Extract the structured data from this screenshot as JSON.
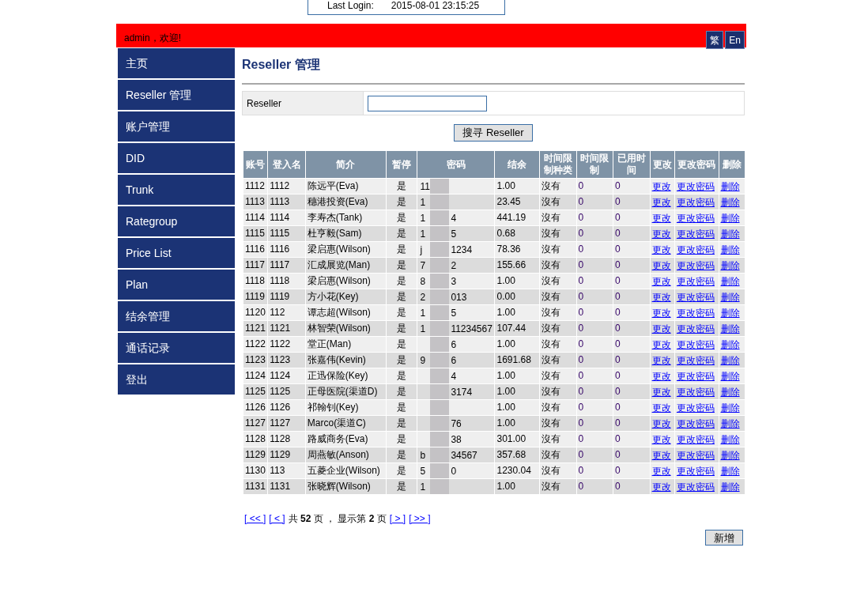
{
  "login_box": {
    "label": "Last Login:",
    "value": "2015-08-01 23:15:25"
  },
  "header": {
    "welcome": "admin，欢迎!",
    "languages": [
      {
        "label": "繁"
      },
      {
        "label": "En"
      }
    ]
  },
  "sidebar": {
    "items": [
      {
        "label": "主页"
      },
      {
        "label": "Reseller 管理"
      },
      {
        "label": "账户管理"
      },
      {
        "label": "DID"
      },
      {
        "label": "Trunk"
      },
      {
        "label": "Rategroup"
      },
      {
        "label": "Price List"
      },
      {
        "label": "Plan"
      },
      {
        "label": "结余管理"
      },
      {
        "label": "通话记录"
      },
      {
        "label": "登出"
      }
    ]
  },
  "page_title": "Reseller 管理",
  "search_form": {
    "label": "Reseller",
    "button": "搜寻 Reseller"
  },
  "table": {
    "columns": [
      "账号",
      "登入名",
      "简介",
      "暂停",
      "密码",
      "结余",
      "时间限制种类",
      "时间限制",
      "已用时间",
      "更改",
      "更改密码",
      "删除"
    ],
    "rows": [
      {
        "account": "1112",
        "login": "1112",
        "intro": "陈远平(Eva)",
        "paused": "是",
        "password_start": "11",
        "balance": "1.00",
        "limit_type": "沒有",
        "limit": "0",
        "used": "0",
        "edit": "更改",
        "change_password": "更改密码",
        "delete": "删除"
      },
      {
        "account": "1113",
        "login": "1113",
        "intro": "穗港投资(Eva)",
        "paused": "是",
        "password_start": "1",
        "balance": "23.45",
        "limit_type": "沒有",
        "limit": "0",
        "used": "0",
        "edit": "更改",
        "change_password": "更改密码",
        "delete": "删除"
      },
      {
        "account": "1114",
        "login": "1114",
        "intro": "李寿杰(Tank)",
        "paused": "是",
        "password_start": "1",
        "password_end": "4",
        "balance": "441.19",
        "limit_type": "沒有",
        "limit": "0",
        "used": "0",
        "edit": "更改",
        "change_password": "更改密码",
        "delete": "删除"
      },
      {
        "account": "1115",
        "login": "1115",
        "intro": "杜亨毅(Sam)",
        "paused": "是",
        "password_start": "1",
        "password_end": "5",
        "balance": "0.68",
        "limit_type": "沒有",
        "limit": "0",
        "used": "0",
        "edit": "更改",
        "change_password": "更改密码",
        "delete": "删除"
      },
      {
        "account": "1116",
        "login": "1116",
        "intro": "梁启惠(Wilson)",
        "paused": "是",
        "password_start": "j",
        "password_end": "1234",
        "balance": "78.36",
        "limit_type": "沒有",
        "limit": "0",
        "used": "0",
        "edit": "更改",
        "change_password": "更改密码",
        "delete": "删除"
      },
      {
        "account": "1117",
        "login": "1117",
        "intro": "汇成展览(Man)",
        "paused": "是",
        "password_start": "7",
        "password_end": "2",
        "balance": "155.66",
        "limit_type": "沒有",
        "limit": "0",
        "used": "0",
        "edit": "更改",
        "change_password": "更改密码",
        "delete": "删除"
      },
      {
        "account": "1118",
        "login": "1118",
        "intro": "梁启惠(Wilson)",
        "paused": "是",
        "password_start": "8",
        "password_end": "3",
        "balance": "1.00",
        "limit_type": "沒有",
        "limit": "0",
        "used": "0",
        "edit": "更改",
        "change_password": "更改密码",
        "delete": "删除"
      },
      {
        "account": "1119",
        "login": "1119",
        "intro": "方小花(Key)",
        "paused": "是",
        "password_start": "2",
        "password_end": "013",
        "balance": "0.00",
        "limit_type": "沒有",
        "limit": "0",
        "used": "0",
        "edit": "更改",
        "change_password": "更改密码",
        "delete": "删除"
      },
      {
        "account": "1120",
        "login": "112",
        "intro": "谭志超(Wilson)",
        "paused": "是",
        "password_start": "1",
        "password_end": "5",
        "balance": "1.00",
        "limit_type": "沒有",
        "limit": "0",
        "used": "0",
        "edit": "更改",
        "change_password": "更改密码",
        "delete": "删除"
      },
      {
        "account": "1121",
        "login": "1121",
        "intro": "林智荣(Wilson)",
        "paused": "是",
        "password_start": "1",
        "password_end": "11234567",
        "balance": "107.44",
        "limit_type": "沒有",
        "limit": "0",
        "used": "0",
        "edit": "更改",
        "change_password": "更改密码",
        "delete": "删除"
      },
      {
        "account": "1122",
        "login": "1122",
        "intro": "堂正(Man)",
        "paused": "是",
        "password_end": "6",
        "balance": "1.00",
        "limit_type": "沒有",
        "limit": "0",
        "used": "0",
        "edit": "更改",
        "change_password": "更改密码",
        "delete": "删除"
      },
      {
        "account": "1123",
        "login": "1123",
        "intro": "张嘉伟(Kevin)",
        "paused": "是",
        "password_start": "9",
        "password_end": "6",
        "balance": "1691.68",
        "limit_type": "沒有",
        "limit": "0",
        "used": "0",
        "edit": "更改",
        "change_password": "更改密码",
        "delete": "删除"
      },
      {
        "account": "1124",
        "login": "1124",
        "intro": "正迅保险(Key)",
        "paused": "是",
        "password_end": "4",
        "balance": "1.00",
        "limit_type": "沒有",
        "limit": "0",
        "used": "0",
        "edit": "更改",
        "change_password": "更改密码",
        "delete": "删除"
      },
      {
        "account": "1125",
        "login": "1125",
        "intro": "正母医院(渠道D)",
        "paused": "是",
        "password_end": "3174",
        "balance": "1.00",
        "limit_type": "沒有",
        "limit": "0",
        "used": "0",
        "edit": "更改",
        "change_password": "更改密码",
        "delete": "删除"
      },
      {
        "account": "1126",
        "login": "1126",
        "intro": "祁翰钊(Key)",
        "paused": "是",
        "balance": "1.00",
        "limit_type": "沒有",
        "limit": "0",
        "used": "0",
        "edit": "更改",
        "change_password": "更改密码",
        "delete": "删除"
      },
      {
        "account": "1127",
        "login": "1127",
        "intro": "Marco(渠道C)",
        "paused": "是",
        "password_end": "76",
        "balance": "1.00",
        "limit_type": "沒有",
        "limit": "0",
        "used": "0",
        "edit": "更改",
        "change_password": "更改密码",
        "delete": "删除"
      },
      {
        "account": "1128",
        "login": "1128",
        "intro": "路威商务(Eva)",
        "paused": "是",
        "password_end": "38",
        "balance": "301.00",
        "limit_type": "沒有",
        "limit": "0",
        "used": "0",
        "edit": "更改",
        "change_password": "更改密码",
        "delete": "删除"
      },
      {
        "account": "1129",
        "login": "1129",
        "intro": "周燕敏(Anson)",
        "paused": "是",
        "password_start": "b",
        "password_end": "34567",
        "balance": "357.68",
        "limit_type": "沒有",
        "limit": "0",
        "used": "0",
        "edit": "更改",
        "change_password": "更改密码",
        "delete": "删除"
      },
      {
        "account": "1130",
        "login": "113",
        "intro": "五菱企业(Wilson)",
        "paused": "是",
        "password_start": "5",
        "password_end": "0",
        "balance": "1230.04",
        "limit_type": "沒有",
        "limit": "0",
        "used": "0",
        "edit": "更改",
        "change_password": "更改密码",
        "delete": "删除"
      },
      {
        "account": "1131",
        "login": "1131",
        "intro": "张晓辉(Wilson)",
        "paused": "是",
        "password_start": "1",
        "balance": "1.00",
        "limit_type": "沒有",
        "limit": "0",
        "used": "0",
        "edit": "更改",
        "change_password": "更改密码",
        "delete": "删除"
      }
    ]
  },
  "pagination": {
    "first": "[ << ]",
    "prev": "[ < ]",
    "summary": "共 **52** 页 ， 显示第 **2** 页",
    "next": "[ > ]",
    "last": "[ >> ]"
  },
  "add_button": "新增"
}
